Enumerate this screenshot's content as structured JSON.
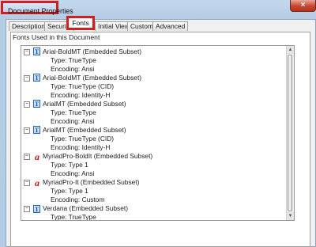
{
  "window": {
    "title": "Document Properties",
    "close_glyph": "×"
  },
  "tabs": [
    {
      "label": "Description",
      "active": false
    },
    {
      "label": "Security",
      "active": false
    },
    {
      "label": "Fonts",
      "active": true
    },
    {
      "label": "Initial View",
      "active": false
    },
    {
      "label": "Custom",
      "active": false
    },
    {
      "label": "Advanced",
      "active": false
    }
  ],
  "section_label": "Fonts Used in this Document",
  "fonts": [
    {
      "name": "Arial-BoldMT (Embedded Subset)",
      "icon": "truetype-icon",
      "type": "Type: TrueType",
      "encoding": "Encoding: Ansi"
    },
    {
      "name": "Arial-BoldMT (Embedded Subset)",
      "icon": "truetype-icon",
      "type": "Type: TrueType (CID)",
      "encoding": "Encoding: Identity-H"
    },
    {
      "name": "ArialMT (Embedded Subset)",
      "icon": "truetype-icon",
      "type": "Type: TrueType",
      "encoding": "Encoding: Ansi"
    },
    {
      "name": "ArialMT (Embedded Subset)",
      "icon": "truetype-icon",
      "type": "Type: TrueType (CID)",
      "encoding": "Encoding: Identity-H"
    },
    {
      "name": "MyriadPro-BoldIt (Embedded Subset)",
      "icon": "type1-icon",
      "type": "Type: Type 1",
      "encoding": "Encoding: Ansi"
    },
    {
      "name": "MyriadPro-It (Embedded Subset)",
      "icon": "type1-icon",
      "type": "Type: Type 1",
      "encoding": "Encoding: Custom"
    },
    {
      "name": "Verdana (Embedded Subset)",
      "icon": "truetype-icon",
      "type": "Type: TrueType",
      "encoding": ""
    }
  ],
  "icons": {
    "truetype_glyph": "T",
    "type1_glyph": "a",
    "collapse_glyph": "−",
    "scroll_up_glyph": "▲",
    "scroll_down_glyph": "▼"
  },
  "colors": {
    "highlight": "#d01f22",
    "truetype_icon": "#1452a0",
    "type1_icon": "#c4161c"
  }
}
